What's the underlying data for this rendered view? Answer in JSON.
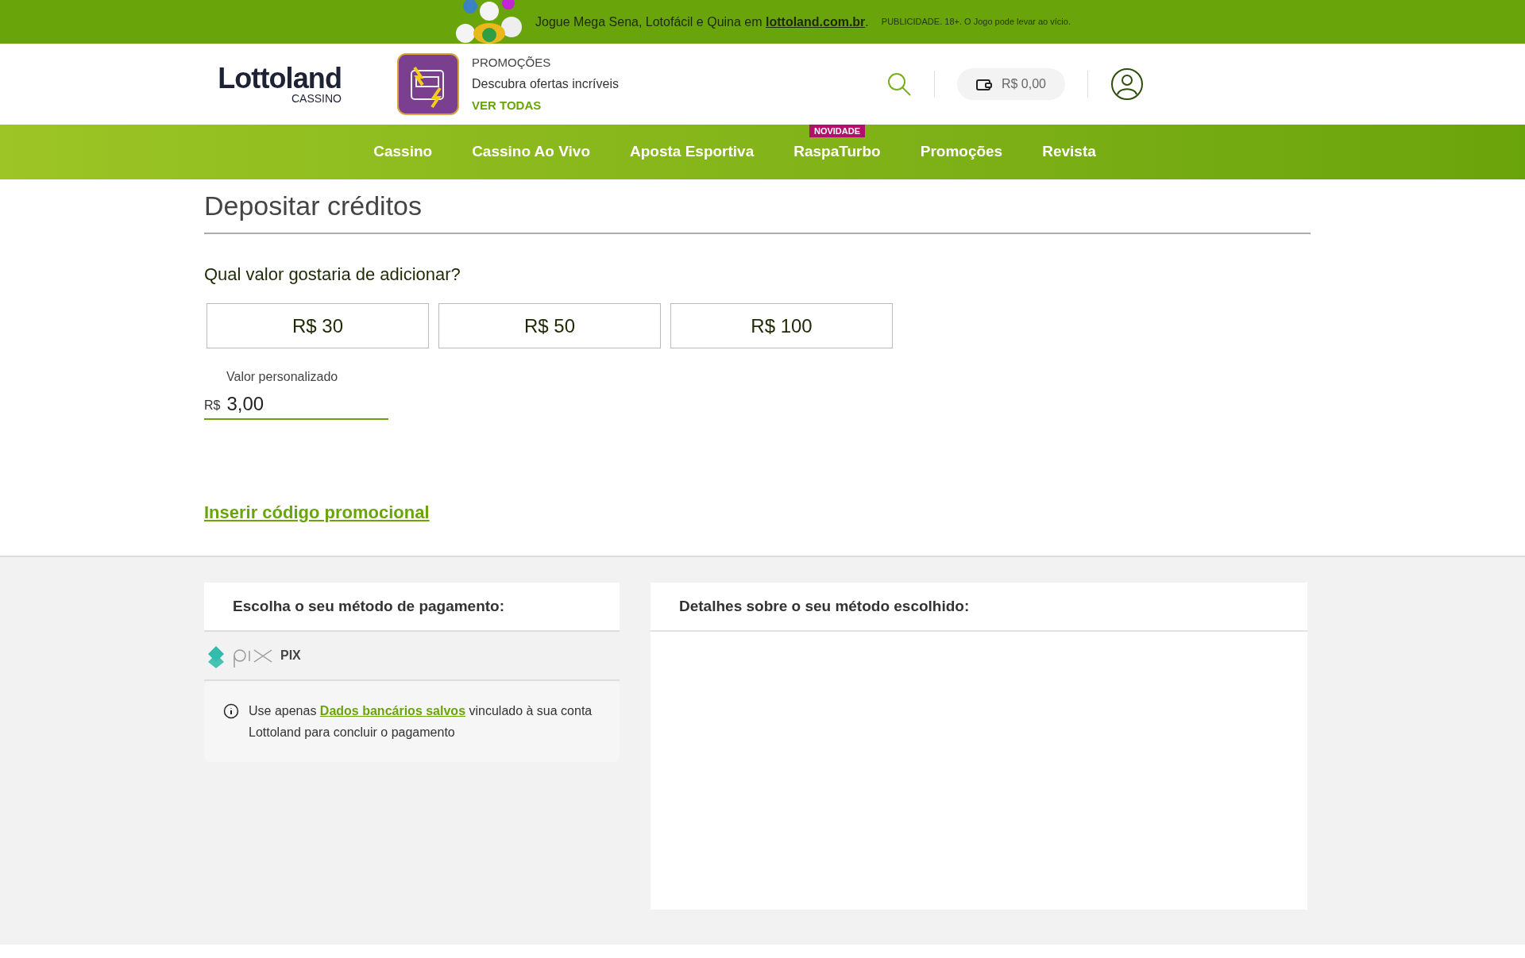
{
  "ad_banner": {
    "text": "Jogue Mega Sena, Lotofácil e Quina em ",
    "link": "lottoland.com.br",
    "after": ".",
    "disclaimer": "PUBLICIDADE. 18+. O Jogo pode levar ao vício."
  },
  "header": {
    "logo": {
      "name": "Lottoland",
      "sub": "CASSINO"
    },
    "promo": {
      "eyebrow": "PROMOÇÕES",
      "text": "Descubra ofertas incríveis",
      "link": "VER TODAS"
    },
    "balance": "R$ 0,00"
  },
  "nav": [
    {
      "label": "Cassino"
    },
    {
      "label": "Cassino Ao Vivo"
    },
    {
      "label": "Aposta Esportiva"
    },
    {
      "label": "RaspaTurbo",
      "badge": "NOVIDADE"
    },
    {
      "label": "Promoções"
    },
    {
      "label": "Revista"
    }
  ],
  "page_title": "Depositar créditos",
  "question": "Qual valor gostaria de adicionar?",
  "amounts": [
    "R$ 30",
    "R$ 50",
    "R$ 100"
  ],
  "custom_amount": {
    "label": "Valor personalizado",
    "currency": "R$",
    "value": "3,00"
  },
  "promo_code_link": "Inserir código promocional",
  "payment_methods": {
    "title": "Escolha o seu método de pagamento:",
    "methods": [
      {
        "label": "PIX"
      }
    ],
    "info": {
      "before": "Use apenas ",
      "link": "Dados bancários salvos",
      "after": " vinculado à sua conta Lottoland para concluir o pagamento"
    }
  },
  "details": {
    "title": "Detalhes sobre o seu método escolhido:"
  }
}
